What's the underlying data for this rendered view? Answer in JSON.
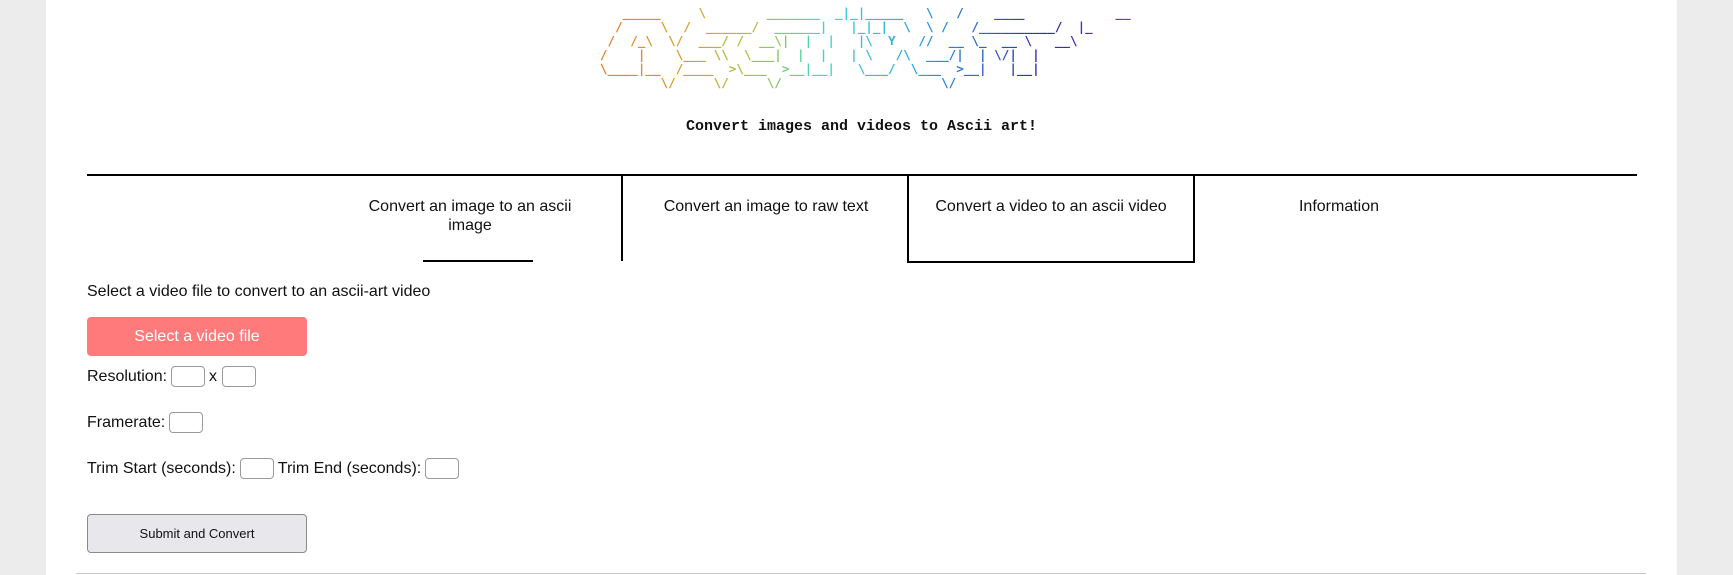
{
  "header": {
    "logo_ascii": "    _____     \\        _______  _|_|_____   \\   /    ____            __\n   /     \\  /  ______/  ______|   |_|_|  \\  \\ /   /__________/  |_\n  /  /_\\  \\/  ___/ /  __\\|  |  |   |\\  Y   //  __ \\_  __ \\   __\\\n /    |    \\___ \\\\  \\___|  |  |   | \\   /\\  ___/|  | \\/|  |\n \\____|__  /____  >\\___  >__|__|   \\___/  \\___  >__|   |__|\n         \\/     \\/     \\/                     \\/",
    "subtitle": "Convert images and videos to Ascii art!"
  },
  "tabs": [
    {
      "label": "Convert an image to an ascii image"
    },
    {
      "label": "Convert an image to raw text"
    },
    {
      "label": "Convert a video to an ascii video"
    },
    {
      "label": "Information"
    }
  ],
  "form": {
    "instructions": "Select a video file to convert to an ascii-art video",
    "select_button": "Select a video file",
    "resolution_label": "Resolution:",
    "resolution_separator": "x",
    "resolution_width": "",
    "resolution_height": "",
    "framerate_label": "Framerate:",
    "framerate_value": "",
    "trim_start_label": "Trim Start (seconds):",
    "trim_start_value": "",
    "trim_end_label": "Trim End (seconds):",
    "trim_end_value": "",
    "submit_button": "Submit and Convert"
  },
  "colors": {
    "select_button_bg": "#ff7b7b",
    "submit_button_bg": "#e8e8ec",
    "page_bg": "#ececec"
  }
}
